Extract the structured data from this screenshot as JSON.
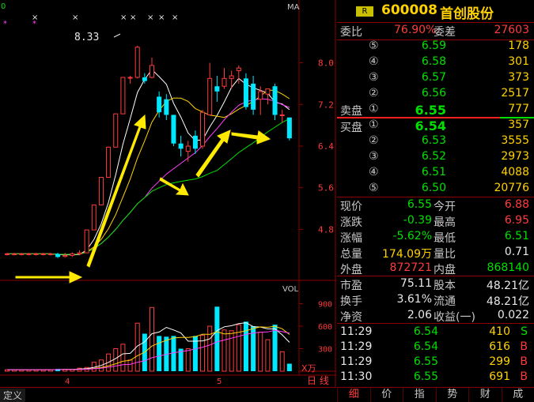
{
  "chart_panel": {
    "ma_label": "MA",
    "vol_label": "VOL",
    "vol_unit": "X万",
    "peak_label": "8.33",
    "yaxis_price": [
      "8.0",
      "7.2",
      "6.4",
      "5.6",
      "4.8"
    ],
    "yaxis_vol": [
      "900",
      "600",
      "300"
    ],
    "x_ticks": [
      "4",
      "5"
    ],
    "period_button": "日 线",
    "left_tab": "定义",
    "top_left_mark": "0"
  },
  "chart_data": {
    "type": "candlestick",
    "price_axis": {
      "min": 4.2,
      "max": 8.6
    },
    "volume_axis": {
      "min": 0,
      "max": 1000
    },
    "candles": [
      {
        "o": 4.33,
        "h": 4.35,
        "l": 4.3,
        "c": 4.33,
        "v": 20
      },
      {
        "o": 4.33,
        "h": 4.35,
        "l": 4.3,
        "c": 4.33,
        "v": 20
      },
      {
        "o": 4.33,
        "h": 4.35,
        "l": 4.3,
        "c": 4.33,
        "v": 20
      },
      {
        "o": 4.33,
        "h": 4.35,
        "l": 4.3,
        "c": 4.33,
        "v": 20
      },
      {
        "o": 4.33,
        "h": 4.35,
        "l": 4.3,
        "c": 4.33,
        "v": 20
      },
      {
        "o": 4.33,
        "h": 4.35,
        "l": 4.3,
        "c": 4.33,
        "v": 20
      },
      {
        "o": 4.33,
        "h": 4.35,
        "l": 4.3,
        "c": 4.33,
        "v": 20
      },
      {
        "o": 4.33,
        "h": 4.35,
        "l": 4.25,
        "c": 4.27,
        "v": 30
      },
      {
        "o": 4.28,
        "h": 4.35,
        "l": 4.26,
        "c": 4.3,
        "v": 25
      },
      {
        "o": 4.3,
        "h": 4.36,
        "l": 4.27,
        "c": 4.33,
        "v": 25
      },
      {
        "o": 4.33,
        "h": 4.4,
        "l": 4.3,
        "c": 4.35,
        "v": 40
      },
      {
        "o": 4.35,
        "h": 4.79,
        "l": 4.35,
        "c": 4.79,
        "v": 50
      },
      {
        "o": 4.79,
        "h": 5.27,
        "l": 4.79,
        "c": 5.27,
        "v": 120
      },
      {
        "o": 5.27,
        "h": 5.8,
        "l": 5.27,
        "c": 5.8,
        "v": 150
      },
      {
        "o": 5.8,
        "h": 6.38,
        "l": 5.8,
        "c": 6.38,
        "v": 230
      },
      {
        "o": 6.38,
        "h": 7.02,
        "l": 6.38,
        "c": 7.02,
        "v": 300
      },
      {
        "o": 7.02,
        "h": 7.72,
        "l": 7.02,
        "c": 7.72,
        "v": 360
      },
      {
        "o": 7.72,
        "h": 7.75,
        "l": 7.6,
        "c": 7.72,
        "v": 150
      },
      {
        "o": 7.72,
        "h": 8.33,
        "l": 7.7,
        "c": 8.3,
        "v": 640
      },
      {
        "o": 7.72,
        "h": 7.8,
        "l": 7.6,
        "c": 7.65,
        "v": 500
      },
      {
        "o": 7.72,
        "h": 8.1,
        "l": 7.7,
        "c": 7.95,
        "v": 850
      },
      {
        "o": 7.35,
        "h": 7.45,
        "l": 6.95,
        "c": 7.05,
        "v": 470
      },
      {
        "o": 7.3,
        "h": 7.4,
        "l": 6.9,
        "c": 7.0,
        "v": 460
      },
      {
        "o": 7.0,
        "h": 7.0,
        "l": 6.4,
        "c": 6.45,
        "v": 470
      },
      {
        "o": 6.45,
        "h": 6.6,
        "l": 6.2,
        "c": 6.35,
        "v": 300
      },
      {
        "o": 6.3,
        "h": 6.5,
        "l": 6.1,
        "c": 6.4,
        "v": 300
      },
      {
        "o": 6.6,
        "h": 6.7,
        "l": 6.25,
        "c": 6.35,
        "v": 470
      },
      {
        "o": 6.4,
        "h": 7.1,
        "l": 6.35,
        "c": 7.05,
        "v": 480
      },
      {
        "o": 7.0,
        "h": 8.0,
        "l": 7.0,
        "c": 7.7,
        "v": 600
      },
      {
        "o": 7.55,
        "h": 7.75,
        "l": 7.25,
        "c": 7.45,
        "v": 860
      },
      {
        "o": 7.55,
        "h": 7.9,
        "l": 7.5,
        "c": 7.7,
        "v": 550
      },
      {
        "o": 7.7,
        "h": 7.85,
        "l": 7.5,
        "c": 7.75,
        "v": 540
      },
      {
        "o": 7.85,
        "h": 7.95,
        "l": 7.6,
        "c": 7.9,
        "v": 620
      },
      {
        "o": 7.7,
        "h": 7.8,
        "l": 7.1,
        "c": 7.15,
        "v": 660
      },
      {
        "o": 7.6,
        "h": 7.75,
        "l": 7.0,
        "c": 7.1,
        "v": 600
      },
      {
        "o": 7.3,
        "h": 7.55,
        "l": 7.0,
        "c": 7.45,
        "v": 520
      },
      {
        "o": 7.4,
        "h": 7.5,
        "l": 7.2,
        "c": 7.5,
        "v": 420
      },
      {
        "o": 7.55,
        "h": 7.6,
        "l": 6.9,
        "c": 7.0,
        "v": 620
      },
      {
        "o": 7.0,
        "h": 7.1,
        "l": 6.85,
        "c": 7.0,
        "v": 260
      },
      {
        "o": 6.95,
        "h": 6.95,
        "l": 6.51,
        "c": 6.55,
        "v": 100
      }
    ]
  },
  "quote": {
    "badge": "R",
    "code": "600008",
    "name": "首创股份",
    "weibi_label": "委比",
    "weibi_value": "76.90%",
    "weicha_label": "委差",
    "weicha_value": "27603",
    "sell_label": "卖盘",
    "buy_label": "买盘",
    "asks": [
      {
        "no": "⑤",
        "price": "6.59",
        "vol": "178"
      },
      {
        "no": "④",
        "price": "6.58",
        "vol": "301"
      },
      {
        "no": "③",
        "price": "6.57",
        "vol": "373"
      },
      {
        "no": "②",
        "price": "6.56",
        "vol": "2517"
      },
      {
        "no": "①",
        "price": "6.55",
        "vol": "777"
      }
    ],
    "bids": [
      {
        "no": "①",
        "price": "6.54",
        "vol": "357"
      },
      {
        "no": "②",
        "price": "6.53",
        "vol": "3555"
      },
      {
        "no": "③",
        "price": "6.52",
        "vol": "2973"
      },
      {
        "no": "④",
        "price": "6.51",
        "vol": "4088"
      },
      {
        "no": "⑤",
        "price": "6.50",
        "vol": "20776"
      }
    ],
    "stats": [
      {
        "l1": "现价",
        "v1": "6.55",
        "l2": "今开",
        "v2": "6.88"
      },
      {
        "l1": "涨跌",
        "v1": "-0.39",
        "l2": "最高",
        "v2": "6.95"
      },
      {
        "l1": "涨幅",
        "v1": "-5.62%",
        "l2": "最低",
        "v2": "6.51"
      },
      {
        "l1": "总量",
        "v1": "174.09万",
        "l2": "量比",
        "v2": "0.71"
      },
      {
        "l1": "外盘",
        "v1": "872721",
        "l2": "内盘",
        "v2": "868140"
      }
    ],
    "fund": [
      {
        "l1": "市盈",
        "v1": "75.11",
        "l2": "股本",
        "v2": "48.21亿"
      },
      {
        "l1": "换手",
        "v1": "3.61%",
        "l2": "流通",
        "v2": "48.21亿"
      },
      {
        "l1": "净资",
        "v1": "2.06",
        "l2": "收益(一)",
        "v2": "0.022"
      }
    ],
    "ticks": [
      {
        "time": "11:29",
        "price": "6.54",
        "vol": "410",
        "side": "S"
      },
      {
        "time": "11:29",
        "price": "6.54",
        "vol": "616",
        "side": "B"
      },
      {
        "time": "11:29",
        "price": "6.55",
        "vol": "299",
        "side": "B"
      },
      {
        "time": "11:30",
        "price": "6.55",
        "vol": "691",
        "side": "B"
      }
    ],
    "tabs": [
      "细",
      "价",
      "指",
      "势",
      "财",
      "成"
    ]
  },
  "colors": {
    "up": "#ff3c3c",
    "down": "#00e8ff",
    "ma5": "#ffffff",
    "ma10": "#ffd200",
    "ma20": "#ff40ff",
    "ma60": "#00e000",
    "arrow": "#ffea00",
    "grid": "#8b0000"
  }
}
